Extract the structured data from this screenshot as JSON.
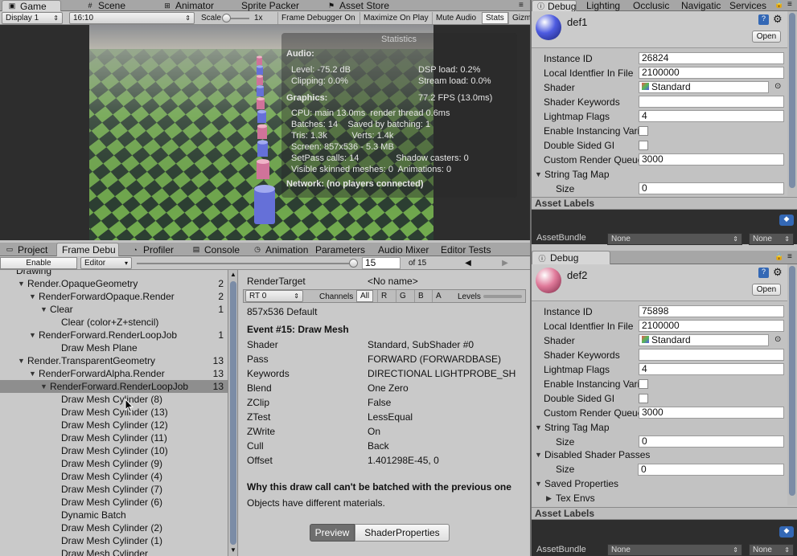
{
  "game": {
    "tabs": [
      "Game",
      "Scene",
      "Animator",
      "Sprite Packer",
      "Asset Store"
    ],
    "toolbar": {
      "display": "Display 1",
      "aspect": "16:10",
      "scale_label": "Scale",
      "scale_value": "1x",
      "frame_debugger": "Frame Debugger On",
      "maximize": "Maximize On Play",
      "mute": "Mute Audio",
      "stats": "Stats",
      "gizmos": "Gizm"
    },
    "stats": {
      "title": "Statistics",
      "audio_h": "Audio:",
      "level": "Level: -75.2 dB",
      "clipping": "Clipping: 0.0%",
      "dsp": "DSP load: 0.2%",
      "stream": "Stream load: 0.0%",
      "graphics_h": "Graphics:",
      "fps": "77.2 FPS (13.0ms)",
      "lines": [
        "CPU: main 13.0ms  render thread 0.6ms",
        "Batches: 14    Saved by batching: 1",
        "Tris: 1.3k          Verts: 1.4k",
        "Screen: 857x536 - 5.3 MB",
        "SetPass calls: 14               Shadow casters: 0",
        "Visible skinned meshes: 0  Animations: 0"
      ],
      "network": "Network: (no players connected)"
    }
  },
  "bottom": {
    "tabs": [
      "Project",
      "Frame Debu",
      "Profiler",
      "Console",
      "Animation",
      "Parameters",
      "Audio Mixer",
      "Editor Tests"
    ],
    "enable": "Enable",
    "editor": "Editor",
    "frame": "15",
    "of": "of 15",
    "tree": [
      {
        "label": "Drawing",
        "indent": 0,
        "tri": "",
        "count": ""
      },
      {
        "label": "Render.OpaqueGeometry",
        "indent": 1,
        "tri": "▼",
        "count": "2"
      },
      {
        "label": "RenderForwardOpaque.Render",
        "indent": 2,
        "tri": "▼",
        "count": "2"
      },
      {
        "label": "Clear",
        "indent": 3,
        "tri": "▼",
        "count": "1"
      },
      {
        "label": "Clear (color+Z+stencil)",
        "indent": 4,
        "tri": "",
        "count": ""
      },
      {
        "label": "RenderForward.RenderLoopJob",
        "indent": 2,
        "tri": "▼",
        "count": "1"
      },
      {
        "label": "Draw Mesh Plane",
        "indent": 4,
        "tri": "",
        "count": ""
      },
      {
        "label": "Render.TransparentGeometry",
        "indent": 1,
        "tri": "▼",
        "count": "13"
      },
      {
        "label": "RenderForwardAlpha.Render",
        "indent": 2,
        "tri": "▼",
        "count": "13"
      },
      {
        "label": "RenderForward.RenderLoopJob",
        "indent": 3,
        "tri": "▼",
        "count": "13",
        "selected": true
      },
      {
        "label": "Draw Mesh Cylinder (8)",
        "indent": 4,
        "tri": "",
        "count": ""
      },
      {
        "label": "Draw Mesh Cylinder (13)",
        "indent": 4,
        "tri": "",
        "count": ""
      },
      {
        "label": "Draw Mesh Cylinder (12)",
        "indent": 4,
        "tri": "",
        "count": ""
      },
      {
        "label": "Draw Mesh Cylinder (11)",
        "indent": 4,
        "tri": "",
        "count": ""
      },
      {
        "label": "Draw Mesh Cylinder (10)",
        "indent": 4,
        "tri": "",
        "count": ""
      },
      {
        "label": "Draw Mesh Cylinder (9)",
        "indent": 4,
        "tri": "",
        "count": ""
      },
      {
        "label": "Draw Mesh Cylinder (4)",
        "indent": 4,
        "tri": "",
        "count": ""
      },
      {
        "label": "Draw Mesh Cylinder (7)",
        "indent": 4,
        "tri": "",
        "count": ""
      },
      {
        "label": "Draw Mesh Cylinder (6)",
        "indent": 4,
        "tri": "",
        "count": ""
      },
      {
        "label": "Dynamic Batch",
        "indent": 4,
        "tri": "",
        "count": ""
      },
      {
        "label": "Draw Mesh Cylinder (2)",
        "indent": 4,
        "tri": "",
        "count": ""
      },
      {
        "label": "Draw Mesh Cylinder (1)",
        "indent": 4,
        "tri": "",
        "count": ""
      },
      {
        "label": "Draw Mesh Cylinder",
        "indent": 4,
        "tri": "",
        "count": ""
      }
    ],
    "detail": {
      "rt_label": "RenderTarget",
      "rt_value": "<No name>",
      "rt_select": "RT 0",
      "channels": "Channels",
      "ch": [
        "All",
        "R",
        "G",
        "B",
        "A"
      ],
      "levels": "Levels",
      "size": "857x536 Default",
      "event": "Event #15: Draw Mesh",
      "props": [
        [
          "Shader",
          "Standard, SubShader #0"
        ],
        [
          "Pass",
          "FORWARD (FORWARDBASE)"
        ],
        [
          "Keywords",
          "DIRECTIONAL LIGHTPROBE_SH"
        ],
        [
          "Blend",
          "One Zero"
        ],
        [
          "ZClip",
          "False"
        ],
        [
          "ZTest",
          "LessEqual"
        ],
        [
          "ZWrite",
          "On"
        ],
        [
          "Cull",
          "Back"
        ],
        [
          "Offset",
          "1.401298E-45, 0"
        ]
      ],
      "why": "Why this draw call can't be batched with the previous one",
      "reason": "Objects have different materials.",
      "preview": "Preview",
      "shader_props": "ShaderProperties"
    }
  },
  "inspector1": {
    "tabs": [
      "Debug",
      "Lighting",
      "Occlusic",
      "Navigatic",
      "Services"
    ],
    "name": "def1",
    "open": "Open",
    "fields": [
      [
        "Instance ID",
        "26824"
      ],
      [
        "Local Identfier In File",
        "2100000"
      ],
      [
        "Shader",
        "Standard"
      ],
      [
        "Shader Keywords",
        ""
      ],
      [
        "Lightmap Flags",
        "4"
      ]
    ],
    "checks": [
      "Enable Instancing Vari",
      "Double Sided GI"
    ],
    "queue_label": "Custom Render Queue",
    "queue": "3000",
    "stringtag": "String Tag Map",
    "size_label": "Size",
    "size": "0",
    "asset_labels": "Asset Labels",
    "bundle": "AssetBundle",
    "none1": "None",
    "none2": "None",
    "ball_color": "#4d5be0"
  },
  "inspector2": {
    "tab": "Debug",
    "name": "def2",
    "open": "Open",
    "fields": [
      [
        "Instance ID",
        "75898"
      ],
      [
        "Local Identfier In File",
        "2100000"
      ],
      [
        "Shader",
        "Standard"
      ],
      [
        "Shader Keywords",
        ""
      ],
      [
        "Lightmap Flags",
        "4"
      ]
    ],
    "checks": [
      "Enable Instancing Vari",
      "Double Sided GI"
    ],
    "queue_label": "Custom Render Queue",
    "queue": "3000",
    "stringtag": "String Tag Map",
    "size_label": "Size",
    "size": "0",
    "disabled": "Disabled Shader Passes",
    "size2": "0",
    "saved": "Saved Properties",
    "tex": "Tex Envs",
    "asset_labels": "Asset Labels",
    "bundle": "AssetBundle",
    "none1": "None",
    "none2": "None",
    "ball_color": "#e07a9a"
  }
}
